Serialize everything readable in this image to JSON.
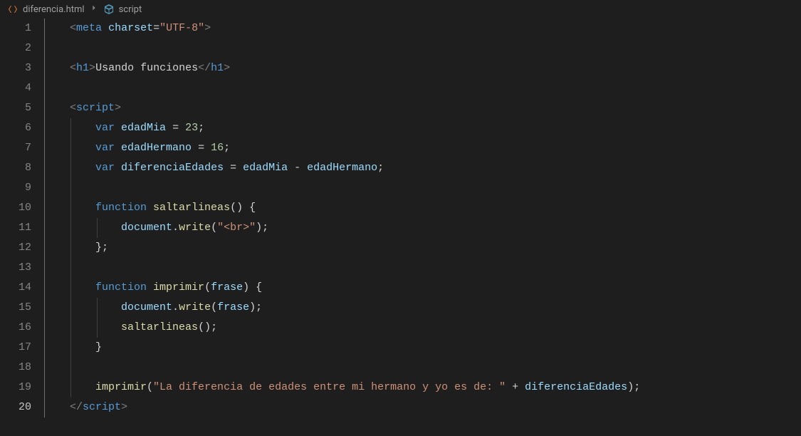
{
  "breadcrumb": {
    "file": "diferencia.html",
    "symbol": "script"
  },
  "lines": {
    "count": 20,
    "active": 20
  },
  "code": {
    "l1": {
      "tag": "meta",
      "attr": "charset",
      "op": "=",
      "val": "\"UTF-8\""
    },
    "l3": {
      "otag": "h1",
      "text": "Usando funciones",
      "ctag": "h1"
    },
    "l5": {
      "otag": "script"
    },
    "l6": {
      "kw": "var",
      "name": "edadMia",
      "eq": " = ",
      "val": "23",
      "semi": ";"
    },
    "l7": {
      "kw": "var",
      "name": "edadHermano",
      "eq": " = ",
      "val": "16",
      "semi": ";"
    },
    "l8": {
      "kw": "var",
      "name": "diferenciaEdades",
      "eq": " = ",
      "a": "edadMia",
      "op": " - ",
      "b": "edadHermano",
      "semi": ";"
    },
    "l10": {
      "kw": "function",
      "name": "saltarlineas",
      "parens": "()",
      "brace": " {"
    },
    "l11": {
      "obj": "document",
      "dot": ".",
      "fn": "write",
      "open": "(",
      "arg": "\"<br>\"",
      "close": ")",
      "semi": ";"
    },
    "l12": {
      "brace": "}",
      "semi": ";"
    },
    "l14": {
      "kw": "function",
      "name": "imprimir",
      "open": "(",
      "param": "frase",
      "close": ")",
      "brace": " {"
    },
    "l15": {
      "obj": "document",
      "dot": ".",
      "fn": "write",
      "open": "(",
      "arg": "frase",
      "close": ")",
      "semi": ";"
    },
    "l16": {
      "fn": "saltarlineas",
      "parens": "()",
      "semi": ";"
    },
    "l17": {
      "brace": "}"
    },
    "l19": {
      "fn": "imprimir",
      "open": "(",
      "str": "\"La diferencia de edades entre mi hermano y yo es de: \"",
      "plus": " + ",
      "var": "diferenciaEdades",
      "close": ")",
      "semi": ";"
    },
    "l20": {
      "ctag": "script"
    }
  }
}
